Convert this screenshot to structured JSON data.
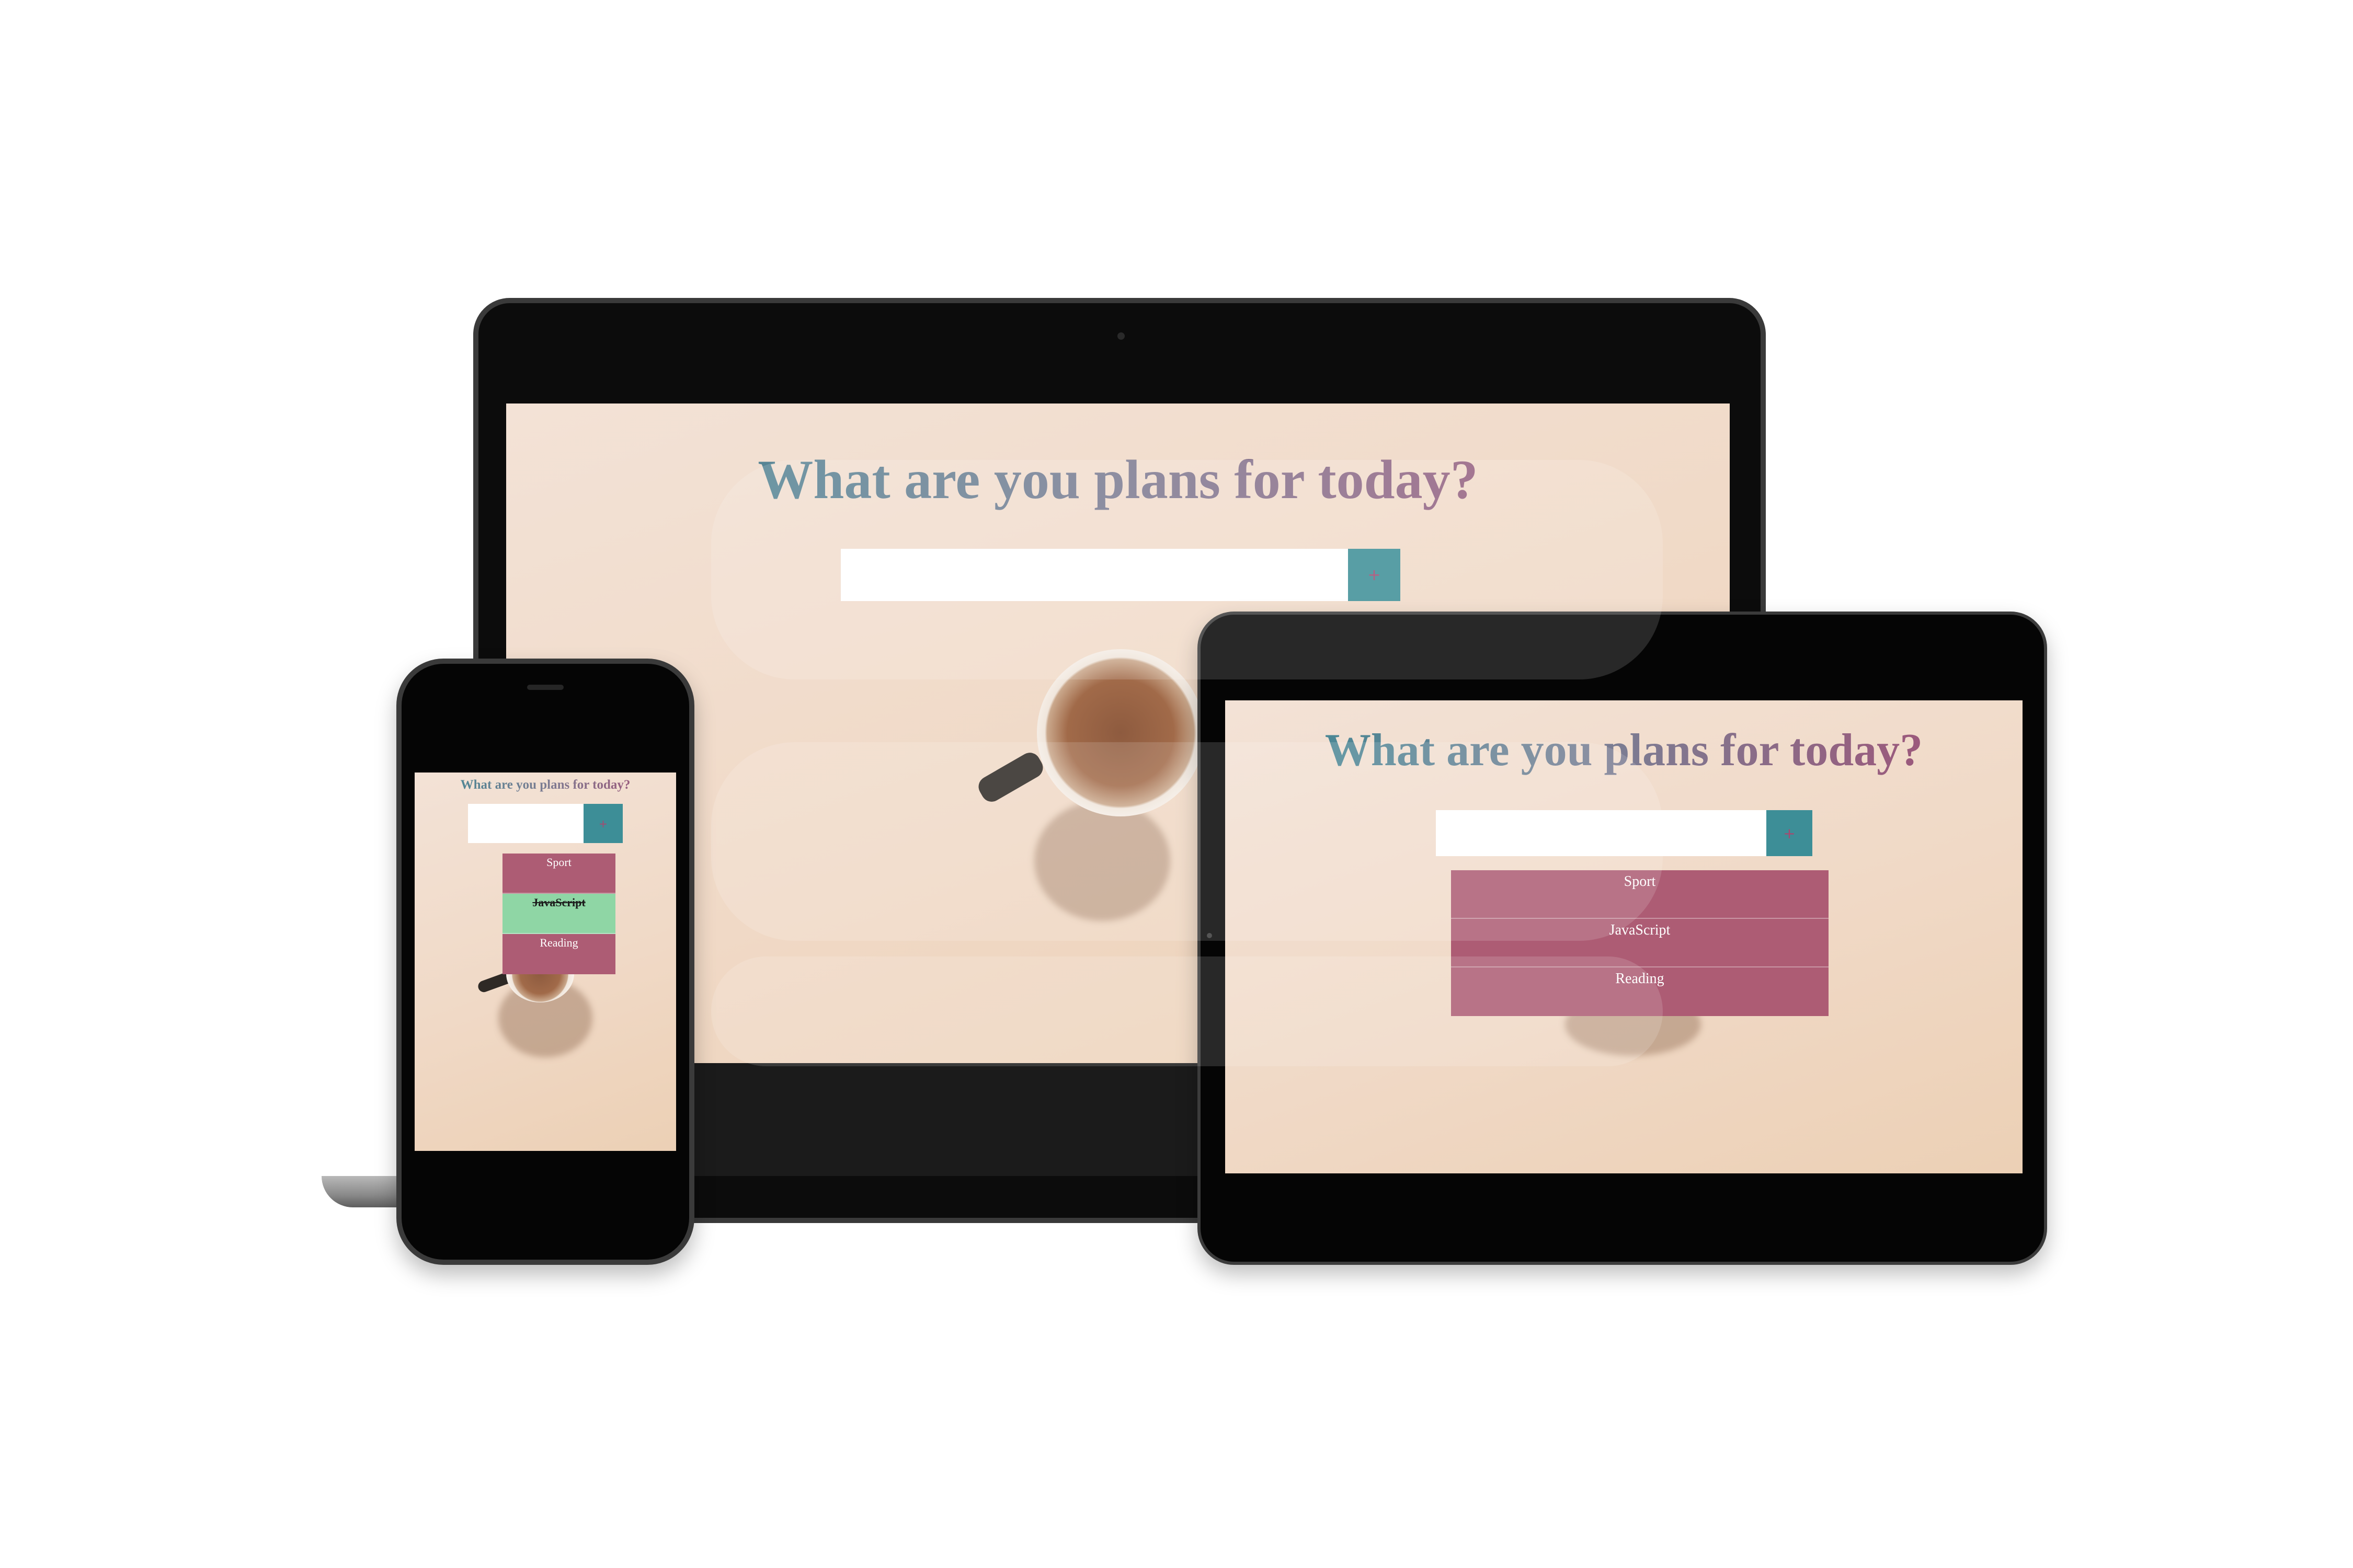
{
  "app": {
    "title": "What are you plans for today?",
    "input_placeholder": "",
    "add_button_label": "+",
    "colors": {
      "title_start": "#3b8b96",
      "title_end": "#a64d74",
      "add_button": "#3d8e97",
      "todo_item": "#ad5c74",
      "completed_item": "#8fd6a5",
      "background": "#f0d9c6"
    }
  },
  "tablet": {
    "todos": [
      {
        "text": "Sport",
        "completed": false
      },
      {
        "text": "JavaScript",
        "completed": false
      },
      {
        "text": "Reading",
        "completed": false
      }
    ]
  },
  "phone": {
    "todos": [
      {
        "text": "Sport",
        "completed": false
      },
      {
        "text": "JavaScript",
        "completed": true
      },
      {
        "text": "Reading",
        "completed": false
      }
    ]
  }
}
